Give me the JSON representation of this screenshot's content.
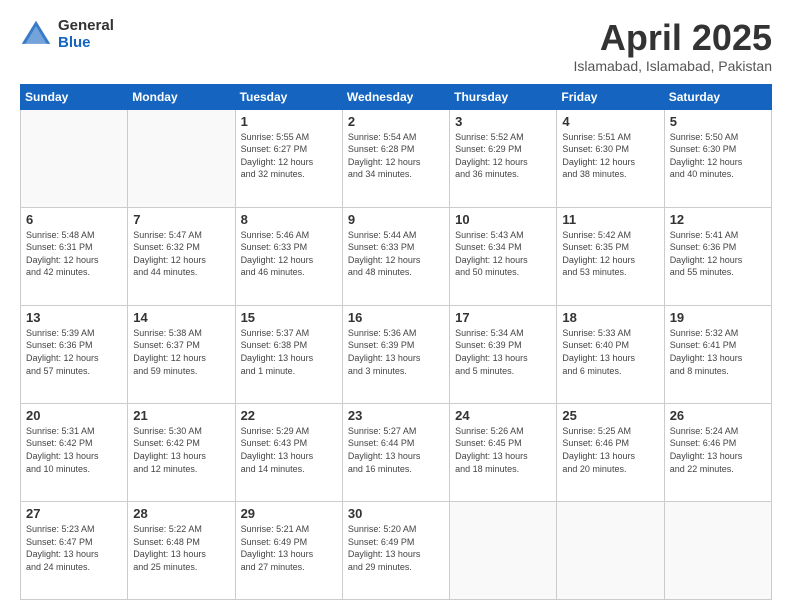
{
  "header": {
    "logo_general": "General",
    "logo_blue": "Blue",
    "month_title": "April 2025",
    "location": "Islamabad, Islamabad, Pakistan"
  },
  "days_of_week": [
    "Sunday",
    "Monday",
    "Tuesday",
    "Wednesday",
    "Thursday",
    "Friday",
    "Saturday"
  ],
  "weeks": [
    [
      {
        "day": "",
        "sunrise": "",
        "sunset": "",
        "daylight": ""
      },
      {
        "day": "",
        "sunrise": "",
        "sunset": "",
        "daylight": ""
      },
      {
        "day": "1",
        "sunrise": "Sunrise: 5:55 AM",
        "sunset": "Sunset: 6:27 PM",
        "daylight": "Daylight: 12 hours and 32 minutes."
      },
      {
        "day": "2",
        "sunrise": "Sunrise: 5:54 AM",
        "sunset": "Sunset: 6:28 PM",
        "daylight": "Daylight: 12 hours and 34 minutes."
      },
      {
        "day": "3",
        "sunrise": "Sunrise: 5:52 AM",
        "sunset": "Sunset: 6:29 PM",
        "daylight": "Daylight: 12 hours and 36 minutes."
      },
      {
        "day": "4",
        "sunrise": "Sunrise: 5:51 AM",
        "sunset": "Sunset: 6:30 PM",
        "daylight": "Daylight: 12 hours and 38 minutes."
      },
      {
        "day": "5",
        "sunrise": "Sunrise: 5:50 AM",
        "sunset": "Sunset: 6:30 PM",
        "daylight": "Daylight: 12 hours and 40 minutes."
      }
    ],
    [
      {
        "day": "6",
        "sunrise": "Sunrise: 5:48 AM",
        "sunset": "Sunset: 6:31 PM",
        "daylight": "Daylight: 12 hours and 42 minutes."
      },
      {
        "day": "7",
        "sunrise": "Sunrise: 5:47 AM",
        "sunset": "Sunset: 6:32 PM",
        "daylight": "Daylight: 12 hours and 44 minutes."
      },
      {
        "day": "8",
        "sunrise": "Sunrise: 5:46 AM",
        "sunset": "Sunset: 6:33 PM",
        "daylight": "Daylight: 12 hours and 46 minutes."
      },
      {
        "day": "9",
        "sunrise": "Sunrise: 5:44 AM",
        "sunset": "Sunset: 6:33 PM",
        "daylight": "Daylight: 12 hours and 48 minutes."
      },
      {
        "day": "10",
        "sunrise": "Sunrise: 5:43 AM",
        "sunset": "Sunset: 6:34 PM",
        "daylight": "Daylight: 12 hours and 50 minutes."
      },
      {
        "day": "11",
        "sunrise": "Sunrise: 5:42 AM",
        "sunset": "Sunset: 6:35 PM",
        "daylight": "Daylight: 12 hours and 53 minutes."
      },
      {
        "day": "12",
        "sunrise": "Sunrise: 5:41 AM",
        "sunset": "Sunset: 6:36 PM",
        "daylight": "Daylight: 12 hours and 55 minutes."
      }
    ],
    [
      {
        "day": "13",
        "sunrise": "Sunrise: 5:39 AM",
        "sunset": "Sunset: 6:36 PM",
        "daylight": "Daylight: 12 hours and 57 minutes."
      },
      {
        "day": "14",
        "sunrise": "Sunrise: 5:38 AM",
        "sunset": "Sunset: 6:37 PM",
        "daylight": "Daylight: 12 hours and 59 minutes."
      },
      {
        "day": "15",
        "sunrise": "Sunrise: 5:37 AM",
        "sunset": "Sunset: 6:38 PM",
        "daylight": "Daylight: 13 hours and 1 minute."
      },
      {
        "day": "16",
        "sunrise": "Sunrise: 5:36 AM",
        "sunset": "Sunset: 6:39 PM",
        "daylight": "Daylight: 13 hours and 3 minutes."
      },
      {
        "day": "17",
        "sunrise": "Sunrise: 5:34 AM",
        "sunset": "Sunset: 6:39 PM",
        "daylight": "Daylight: 13 hours and 5 minutes."
      },
      {
        "day": "18",
        "sunrise": "Sunrise: 5:33 AM",
        "sunset": "Sunset: 6:40 PM",
        "daylight": "Daylight: 13 hours and 6 minutes."
      },
      {
        "day": "19",
        "sunrise": "Sunrise: 5:32 AM",
        "sunset": "Sunset: 6:41 PM",
        "daylight": "Daylight: 13 hours and 8 minutes."
      }
    ],
    [
      {
        "day": "20",
        "sunrise": "Sunrise: 5:31 AM",
        "sunset": "Sunset: 6:42 PM",
        "daylight": "Daylight: 13 hours and 10 minutes."
      },
      {
        "day": "21",
        "sunrise": "Sunrise: 5:30 AM",
        "sunset": "Sunset: 6:42 PM",
        "daylight": "Daylight: 13 hours and 12 minutes."
      },
      {
        "day": "22",
        "sunrise": "Sunrise: 5:29 AM",
        "sunset": "Sunset: 6:43 PM",
        "daylight": "Daylight: 13 hours and 14 minutes."
      },
      {
        "day": "23",
        "sunrise": "Sunrise: 5:27 AM",
        "sunset": "Sunset: 6:44 PM",
        "daylight": "Daylight: 13 hours and 16 minutes."
      },
      {
        "day": "24",
        "sunrise": "Sunrise: 5:26 AM",
        "sunset": "Sunset: 6:45 PM",
        "daylight": "Daylight: 13 hours and 18 minutes."
      },
      {
        "day": "25",
        "sunrise": "Sunrise: 5:25 AM",
        "sunset": "Sunset: 6:46 PM",
        "daylight": "Daylight: 13 hours and 20 minutes."
      },
      {
        "day": "26",
        "sunrise": "Sunrise: 5:24 AM",
        "sunset": "Sunset: 6:46 PM",
        "daylight": "Daylight: 13 hours and 22 minutes."
      }
    ],
    [
      {
        "day": "27",
        "sunrise": "Sunrise: 5:23 AM",
        "sunset": "Sunset: 6:47 PM",
        "daylight": "Daylight: 13 hours and 24 minutes."
      },
      {
        "day": "28",
        "sunrise": "Sunrise: 5:22 AM",
        "sunset": "Sunset: 6:48 PM",
        "daylight": "Daylight: 13 hours and 25 minutes."
      },
      {
        "day": "29",
        "sunrise": "Sunrise: 5:21 AM",
        "sunset": "Sunset: 6:49 PM",
        "daylight": "Daylight: 13 hours and 27 minutes."
      },
      {
        "day": "30",
        "sunrise": "Sunrise: 5:20 AM",
        "sunset": "Sunset: 6:49 PM",
        "daylight": "Daylight: 13 hours and 29 minutes."
      },
      {
        "day": "",
        "sunrise": "",
        "sunset": "",
        "daylight": ""
      },
      {
        "day": "",
        "sunrise": "",
        "sunset": "",
        "daylight": ""
      },
      {
        "day": "",
        "sunrise": "",
        "sunset": "",
        "daylight": ""
      }
    ]
  ]
}
